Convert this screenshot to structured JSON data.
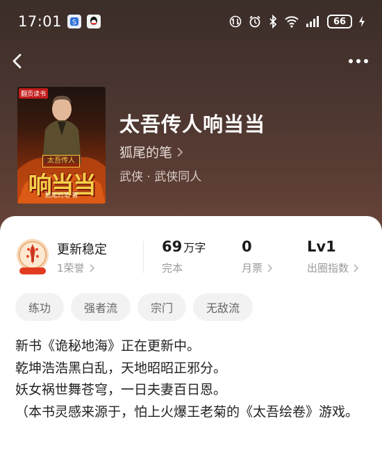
{
  "status_bar": {
    "time": "17:01",
    "battery": "66",
    "icons": [
      "app-notification-icon",
      "qq-icon",
      "network-speed-icon",
      "alarm-icon",
      "bluetooth-icon",
      "wifi-icon",
      "signal-icon",
      "battery-icon",
      "charging-icon"
    ]
  },
  "nav": {
    "back_icon": "chevron-left-icon",
    "more_icon": "more-dots-icon"
  },
  "book": {
    "title": "太吾传人响当当",
    "author": "狐尾的笔",
    "genre": "武侠 · 武侠同人",
    "cover": {
      "badge": "翻页读书",
      "small_title": "太吾传人",
      "big_title": "响当当",
      "author": "狐尾的笔 著"
    }
  },
  "stats": {
    "honor_title": "更新稳定",
    "honor_count": "1荣誉",
    "words_value": "69",
    "words_unit": "万字",
    "words_label": "完本",
    "monthly_votes_value": "0",
    "monthly_votes_label": "月票",
    "index_value": "Lv1",
    "index_label": "出圈指数"
  },
  "tags": [
    "练功",
    "强者流",
    "宗门",
    "无敌流"
  ],
  "description": [
    "新书《诡秘地海》正在更新中。",
    "乾坤浩浩黑白乱，天地昭昭正邪分。",
    "妖女祸世舞苍穹，一日夫妻百日恩。",
    "（本书灵感来源于，怕上火爆王老菊的《太吾绘卷》游戏。"
  ],
  "colors": {
    "hero_bg": "#4a3530",
    "sheet_bg": "#ffffff",
    "tag_bg": "#f2f2f2",
    "text_primary": "#1a1a1a",
    "text_secondary": "#9a9a9a"
  }
}
